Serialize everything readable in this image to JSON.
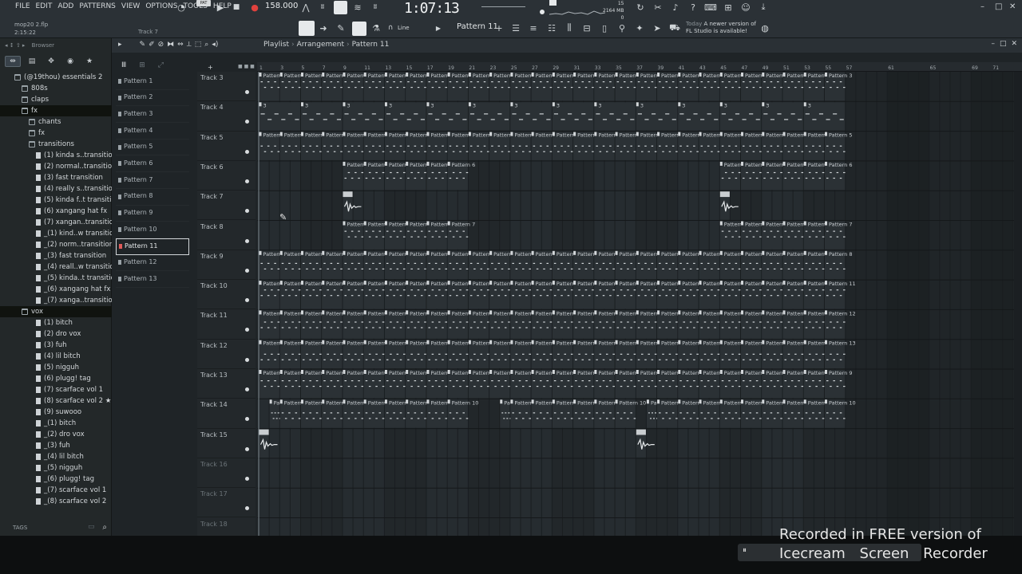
{
  "menu": [
    "FILE",
    "EDIT",
    "ADD",
    "PATTERNS",
    "VIEW",
    "OPTIONS",
    "TOOLS",
    "HELP"
  ],
  "song": {
    "file": "mop20 2.flp",
    "time": "2:15:22"
  },
  "hint_track": "Track 7",
  "transport": {
    "pat_label": "PAT",
    "tempo": "158.000",
    "time": "1:07:13"
  },
  "cpu": {
    "line1": "15",
    "line2": "2164 MB",
    "line3": "0"
  },
  "snap": "Line",
  "current_pattern": "Pattern 11",
  "news": {
    "today": "Today",
    "line1": "A newer version of",
    "line2": "FL Studio is available!"
  },
  "browser": {
    "title": "Browser",
    "tags": "TAGS",
    "tree": [
      {
        "label": "(@19thou) essentials 2",
        "indent": 0,
        "type": "folder"
      },
      {
        "label": "808s",
        "indent": 1,
        "type": "folder"
      },
      {
        "label": "claps",
        "indent": 1,
        "type": "folder"
      },
      {
        "label": "fx",
        "indent": 1,
        "type": "folder",
        "selected": true
      },
      {
        "label": "chants",
        "indent": 2,
        "type": "folder"
      },
      {
        "label": "fx",
        "indent": 2,
        "type": "folder"
      },
      {
        "label": "transitions",
        "indent": 2,
        "type": "folder"
      },
      {
        "label": "(1) kinda s..transition",
        "indent": 3,
        "type": "file"
      },
      {
        "label": "(2) normal..transition",
        "indent": 3,
        "type": "file"
      },
      {
        "label": "(3) fast transition",
        "indent": 3,
        "type": "file"
      },
      {
        "label": "(4) really s..transition",
        "indent": 3,
        "type": "file"
      },
      {
        "label": "(5) kinda f..t transition",
        "indent": 3,
        "type": "file"
      },
      {
        "label": "(6) xangang hat fx",
        "indent": 3,
        "type": "file"
      },
      {
        "label": "(7) xangan..transition",
        "indent": 3,
        "type": "file"
      },
      {
        "label": "_(1) kind..w transition",
        "indent": 3,
        "type": "file"
      },
      {
        "label": "_(2) norm..transition",
        "indent": 3,
        "type": "file"
      },
      {
        "label": "_(3) fast transition",
        "indent": 3,
        "type": "file"
      },
      {
        "label": "_(4) reall..w transition",
        "indent": 3,
        "type": "file"
      },
      {
        "label": "_(5) kinda..t transition",
        "indent": 3,
        "type": "file"
      },
      {
        "label": "_(6) xangang hat fx",
        "indent": 3,
        "type": "file"
      },
      {
        "label": "_(7) xanga..transition",
        "indent": 3,
        "type": "file"
      },
      {
        "label": "vox",
        "indent": 1,
        "type": "folder",
        "selected": true
      },
      {
        "label": "(1) bitch",
        "indent": 3,
        "type": "file"
      },
      {
        "label": "(2) dro vox",
        "indent": 3,
        "type": "file"
      },
      {
        "label": "(3) fuh",
        "indent": 3,
        "type": "file"
      },
      {
        "label": "(4) lil bitch",
        "indent": 3,
        "type": "file"
      },
      {
        "label": "(5) nigguh",
        "indent": 3,
        "type": "file"
      },
      {
        "label": "(6) plugg! tag",
        "indent": 3,
        "type": "file"
      },
      {
        "label": "(7) scarface vol 1",
        "indent": 3,
        "type": "file"
      },
      {
        "label": "(8) scarface vol 2 ★",
        "indent": 3,
        "type": "file"
      },
      {
        "label": "(9) suwooo",
        "indent": 3,
        "type": "file"
      },
      {
        "label": "_(1) bitch",
        "indent": 3,
        "type": "file"
      },
      {
        "label": "_(2) dro vox",
        "indent": 3,
        "type": "file"
      },
      {
        "label": "_(3) fuh",
        "indent": 3,
        "type": "file"
      },
      {
        "label": "_(4) lil bitch",
        "indent": 3,
        "type": "file"
      },
      {
        "label": "_(5) nigguh",
        "indent": 3,
        "type": "file"
      },
      {
        "label": "_(6) plugg! tag",
        "indent": 3,
        "type": "file"
      },
      {
        "label": "_(7) scarface vol 1",
        "indent": 3,
        "type": "file"
      },
      {
        "label": "_(8) scarface vol 2",
        "indent": 3,
        "type": "file"
      }
    ]
  },
  "playlist": {
    "title": "Playlist",
    "sep": "›",
    "view": "Arrangement",
    "pattern": "Pattern 11",
    "patterns": [
      "Pattern 1",
      "Pattern 2",
      "Pattern 3",
      "Pattern 4",
      "Pattern 5",
      "Pattern 6",
      "Pattern 7",
      "Pattern 8",
      "Pattern 9",
      "Pattern 10",
      "Pattern 11",
      "Pattern 12",
      "Pattern 13"
    ],
    "selected_pattern": 10,
    "ruler": [
      1,
      3,
      5,
      7,
      9,
      11,
      13,
      15,
      17,
      19,
      21,
      23,
      25,
      27,
      29,
      31,
      33,
      35,
      37,
      39,
      41,
      43,
      45,
      47,
      49,
      51,
      53,
      55,
      57,
      61,
      65,
      69,
      71
    ],
    "tracks": [
      {
        "name": "Track 3",
        "empty": false,
        "clips": [
          {
            "label": "Pattern 3",
            "from": 1,
            "to": 57,
            "step": 2
          }
        ]
      },
      {
        "name": "Track 4",
        "empty": false,
        "clips": [
          {
            "label": "3",
            "from": 1,
            "to": 57,
            "step": 4
          }
        ]
      },
      {
        "name": "Track 5",
        "empty": false,
        "clips": [
          {
            "label": "Pattern 5",
            "from": 1,
            "to": 57,
            "step": 2
          }
        ]
      },
      {
        "name": "Track 6",
        "empty": false,
        "clips": [
          {
            "label": "Pattern 6",
            "from": 9,
            "to": 21,
            "step": 2
          },
          {
            "label": "Pattern 6",
            "from": 45,
            "to": 57,
            "step": 2
          }
        ]
      },
      {
        "name": "Track 7",
        "empty": false,
        "clips": [
          {
            "label": "",
            "from": 9,
            "to": 10,
            "step": 1,
            "audio": true
          },
          {
            "label": "",
            "from": 45,
            "to": 46,
            "step": 1,
            "audio": true
          }
        ]
      },
      {
        "name": "Track 8",
        "empty": false,
        "clips": [
          {
            "label": "Pattern 7",
            "from": 9,
            "to": 21,
            "step": 2
          },
          {
            "label": "Pattern 7",
            "from": 45,
            "to": 57,
            "step": 2
          }
        ]
      },
      {
        "name": "Track 9",
        "empty": false,
        "clips": [
          {
            "label": "Pattern 8",
            "from": 1,
            "to": 57,
            "step": 2
          }
        ]
      },
      {
        "name": "Track 10",
        "empty": false,
        "clips": [
          {
            "label": "Pattern 11",
            "from": 1,
            "to": 57,
            "step": 2
          }
        ]
      },
      {
        "name": "Track 11",
        "empty": false,
        "clips": [
          {
            "label": "Pattern 12",
            "from": 1,
            "to": 57,
            "step": 2
          }
        ]
      },
      {
        "name": "Track 12",
        "empty": false,
        "clips": [
          {
            "label": "Pattern 13",
            "from": 1,
            "to": 57,
            "step": 2
          }
        ]
      },
      {
        "name": "Track 13",
        "empty": false,
        "clips": [
          {
            "label": "Pattern 9",
            "from": 1,
            "to": 57,
            "step": 2
          }
        ]
      },
      {
        "name": "Track 14",
        "empty": false,
        "clips": [
          {
            "label": "Pat..0",
            "from": 2,
            "to": 3,
            "step": 1
          },
          {
            "label": "Pattern 10",
            "from": 3,
            "to": 21,
            "step": 2
          },
          {
            "label": "Pat..0",
            "from": 24,
            "to": 25,
            "step": 1
          },
          {
            "label": "Pattern 10",
            "from": 25,
            "to": 37,
            "step": 2
          },
          {
            "label": "Pat..0",
            "from": 38,
            "to": 39,
            "step": 1
          },
          {
            "label": "Pattern 10",
            "from": 39,
            "to": 57,
            "step": 2
          }
        ]
      },
      {
        "name": "Track 15",
        "empty": false,
        "clips": [
          {
            "label": "",
            "from": 1,
            "to": 2,
            "step": 1,
            "audio": true
          },
          {
            "label": "",
            "from": 37,
            "to": 38,
            "step": 1,
            "audio": true
          }
        ]
      },
      {
        "name": "Track 16",
        "empty": true,
        "clips": []
      },
      {
        "name": "Track 17",
        "empty": true,
        "clips": []
      },
      {
        "name": "Track 18",
        "empty": true,
        "clips": []
      }
    ]
  },
  "watermark": {
    "line1": "Recorded in FREE version of",
    "line2": "Icecream Screen Recorder"
  }
}
